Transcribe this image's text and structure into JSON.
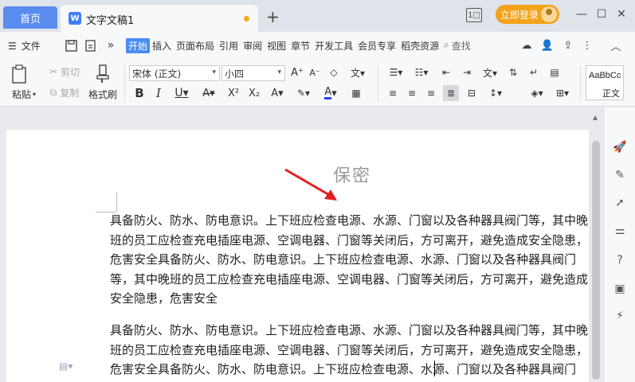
{
  "titlebar": {
    "home_tab": "首页",
    "doc_tab_icon": "W",
    "doc_tab_title": "文字文稿1",
    "new_tab": "+",
    "layout_icon": "1□",
    "login_label": "立即登录",
    "minimize": "—",
    "maximize": "☐",
    "close": "✕"
  },
  "menubar": {
    "file_label": "文件",
    "tabs": [
      "开始",
      "插入",
      "页面布局",
      "引用",
      "审阅",
      "视图",
      "章节",
      "开发工具",
      "会员专享",
      "稻壳资源"
    ],
    "active_tab": "开始",
    "search_label": "查找"
  },
  "ribbon": {
    "paste_label": "粘贴",
    "cut_label": "剪切",
    "copy_label": "复制",
    "format_painter_label": "格式刷",
    "font_name": "宋体 (正文)",
    "font_size": "小四",
    "style_preview": "AaBbCc",
    "style_name": "正文"
  },
  "document": {
    "watermark": "保密",
    "paragraph1": "具备防火、防水、防电意识。上下班应检查电源、水源、门窗以及各种器具阀门等，其中晚班的员工应检查充电插座电源、空调电器、门窗等关闭后，方可离开，避免造成安全隐患，危害安全具备防火、防水、防电意识。上下班应检查电源、水源、门窗以及各种器具阀门等，其中晚班的员工应检查充电插座电源、空调电器、门窗等关闭后，方可离开，避免造成安全隐患，危害安全",
    "paragraph2": "具备防火、防水、防电意识。上下班应检查电源、水源、门窗以及各种器具阀门等，其中晚班的员工应检查充电插座电源、空调电器、门窗等关闭后，方可离开，避免造成安全隐患，危害安全具备防火、防水、防电意识。上下班应检查电源、水源、门窗以及各种器具阀门等，其中晚班的员工应检查充电插座电源、空调电器"
  },
  "colors": {
    "home_tab": "#5a8cf0",
    "active_menu": "#4b8cf4",
    "login_button": "#f3a219",
    "annotation_arrow": "#e02020"
  }
}
